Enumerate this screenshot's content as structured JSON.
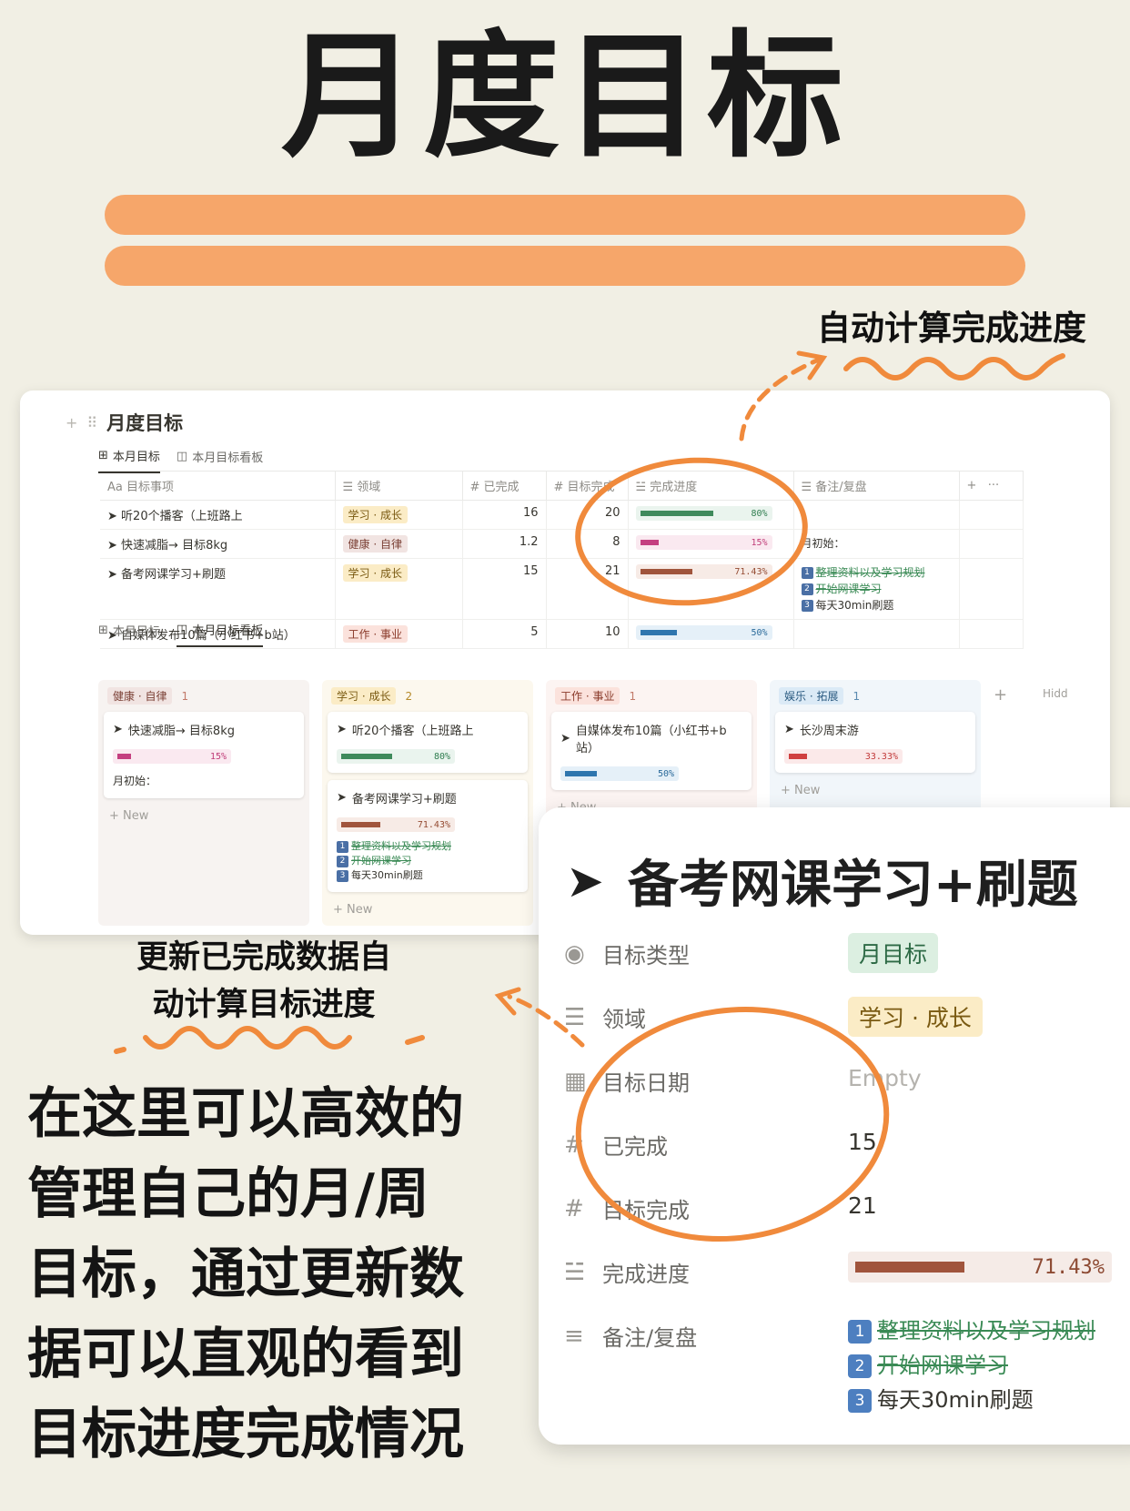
{
  "poster": {
    "title": "月度目标",
    "annotation_top": "自动计算完成进度",
    "annotation_mid_line1": "更新已完成数据自",
    "annotation_mid_line2": "动计算目标进度",
    "description": [
      "在这里可以高效的",
      "管理自己的月/周",
      "目标，通过更新数",
      "据可以直观的看到",
      "目标进度完成情况"
    ]
  },
  "colors": {
    "brush": "#f6a66a",
    "circle": "#f08a3c",
    "background": "#f1efe4"
  },
  "database": {
    "title": "月度目标",
    "views": [
      "本月目标",
      "本月目标看板"
    ],
    "columns": [
      "Aa 目标事项",
      "领域",
      "已完成",
      "目标完成",
      "完成进度",
      "备注/复盘"
    ],
    "rows": [
      {
        "name": "听20个播客（上班路上",
        "area": "学习 · 成长",
        "done": "16",
        "target": "20",
        "progress": 0.8,
        "progress_label": "80%",
        "notes": []
      },
      {
        "name": "快速减脂→ 目标8kg",
        "area": "健康 · 自律",
        "done": "1.2",
        "target": "8",
        "progress": 0.15,
        "progress_label": "15%",
        "notes_text": "月初始："
      },
      {
        "name": "备考网课学习+刷题",
        "area": "学习 · 成长",
        "done": "15",
        "target": "21",
        "progress": 0.7143,
        "progress_label": "71.43%",
        "notes": [
          {
            "num": "1",
            "text": "整理资料以及学习规划",
            "done": true
          },
          {
            "num": "2",
            "text": "开始网课学习",
            "done": true
          },
          {
            "num": "3",
            "text": "每天30min刷题",
            "done": false
          }
        ]
      },
      {
        "name": "自媒体发布10篇（小红书+b站）",
        "area": "工作 · 事业",
        "done": "5",
        "target": "10",
        "progress": 0.5,
        "progress_label": "50%",
        "notes": []
      }
    ],
    "board": [
      {
        "group": "健康 · 自律",
        "count": "1",
        "cards": [
          {
            "name": "快速减脂→ 目标8kg",
            "progress": 0.15,
            "label": "15%",
            "note": "月初始："
          }
        ]
      },
      {
        "group": "学习 · 成长",
        "count": "2",
        "cards": [
          {
            "name": "听20个播客（上班路上",
            "progress": 0.8,
            "label": "80%"
          },
          {
            "name": "备考网课学习+刷题",
            "progress": 0.7143,
            "label": "71.43%"
          }
        ]
      },
      {
        "group": "工作 · 事业",
        "count": "1",
        "cards": [
          {
            "name": "自媒体发布10篇（小红书+b站）",
            "progress": 0.5,
            "label": "50%"
          }
        ]
      },
      {
        "group": "娱乐 · 拓展",
        "count": "1",
        "cards": [
          {
            "name": "长沙周末游",
            "progress": 0.3333,
            "label": "33.33%"
          }
        ]
      }
    ],
    "new_label": "New",
    "hidden_label": "Hidd"
  },
  "detail": {
    "title": "备考网课学习+刷题",
    "props": {
      "type_label": "目标类型",
      "type_value": "月目标",
      "area_label": "领域",
      "area_value": "学习 · 成长",
      "date_label": "目标日期",
      "date_value": "Empty",
      "done_label": "已完成",
      "done_value": "15",
      "target_label": "目标完成",
      "target_value": "21",
      "progress_label": "完成进度",
      "progress_value": "71.43%",
      "notes_label": "备注/复盘",
      "notes": [
        "整理资料以及学习规划",
        "开始网课学习",
        "每天30min刷题"
      ]
    }
  }
}
